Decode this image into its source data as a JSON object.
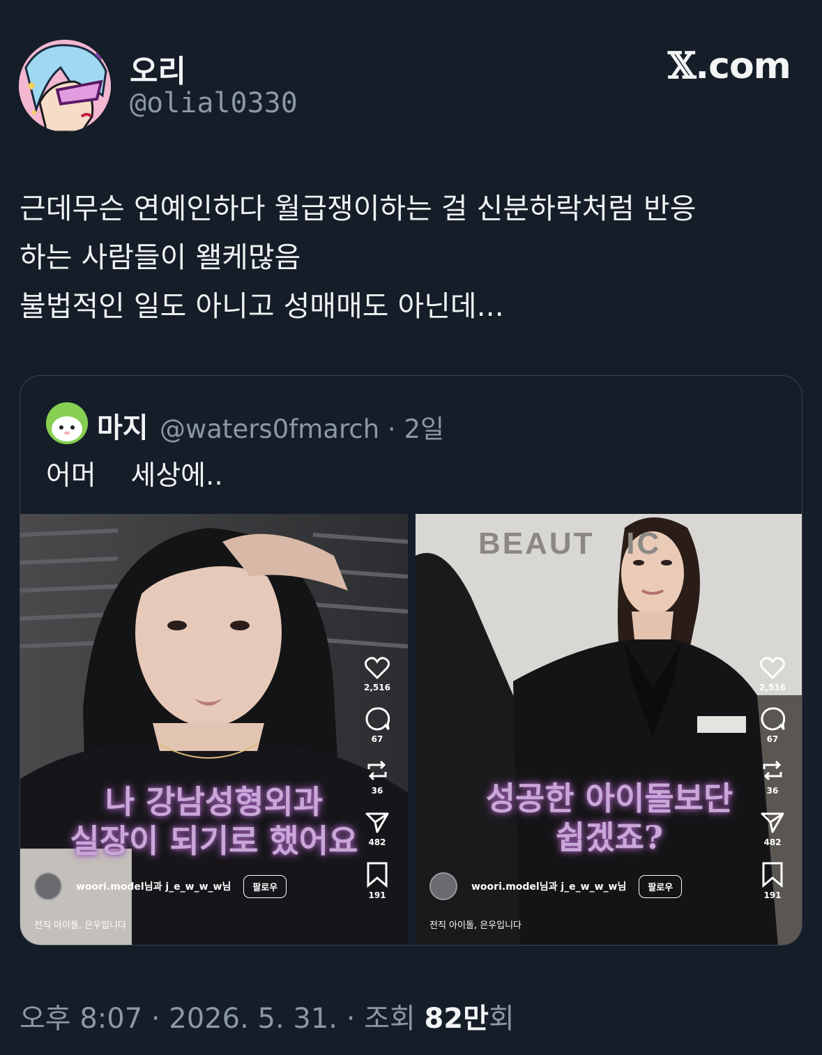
{
  "author": {
    "display_name": "오리",
    "handle": "@olial0330"
  },
  "brand": {
    "x_mark": "𝕏",
    "domain": ".com"
  },
  "tweet": {
    "lines": [
      "근데무슨 연예인하다 월급쟁이하는 걸 신분하락처럼 반응",
      "하는 사람들이 왤케많음",
      "불법적인 일도 아니고 성매매도 아닌데..."
    ]
  },
  "quote": {
    "display_name": "마지",
    "handle_line": "@waters0fmarch · 2일",
    "text": "어머    세상에..",
    "media": [
      {
        "caption_lines": [
          "나 강남성형외과",
          "실장이 되기로 했어요"
        ],
        "likes": "2,516",
        "comments": "67",
        "reposts": "36",
        "shares": "482",
        "saves": "191",
        "users": "woori.model님과 j_e_w_w_w님",
        "follow_label": "팔로우",
        "description": "전직 아이돌, 은우입니다"
      },
      {
        "caption_lines": [
          "성공한 아이돌보단",
          "쉽겠죠?"
        ],
        "likes": "2,516",
        "comments": "67",
        "reposts": "36",
        "shares": "482",
        "saves": "191",
        "users": "woori.model님과 j_e_w_w_w님",
        "follow_label": "팔로우",
        "description": "전직 아이돌, 은우입니다",
        "sign_text": "BEAUT   IC"
      }
    ]
  },
  "footer": {
    "time_date": "오후 8:07 · 2026. 5. 31. · 조회 ",
    "views": "82만",
    "views_suffix": "회"
  }
}
